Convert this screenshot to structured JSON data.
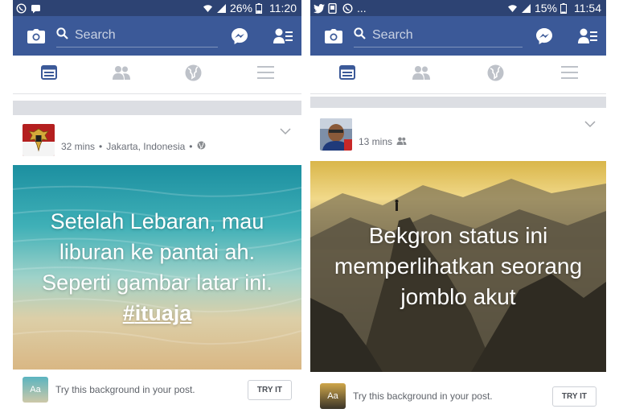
{
  "left": {
    "status_bar": {
      "battery": "26%",
      "time": "11:20"
    },
    "search": {
      "placeholder": "Search"
    },
    "post": {
      "time": "32 mins",
      "separator": "•",
      "location": "Jakarta, Indonesia",
      "background_text_line1": "Setelah Lebaran, mau",
      "background_text_line2": "liburan ke pantai ah.",
      "background_text_line3": "Seperti gambar latar ini.",
      "hashtag_prefix": "#",
      "hashtag": "ituaja"
    },
    "try_bar": {
      "thumb_label": "Aa",
      "text": "Try this background in your post.",
      "button": "TRY IT"
    }
  },
  "right": {
    "status_bar": {
      "extra": "...",
      "battery": "15%",
      "time": "11:54"
    },
    "search": {
      "placeholder": "Search"
    },
    "post": {
      "time": "13 mins",
      "background_text_line1": "Bekgron status ini",
      "background_text_line2": "memperlihatkan seorang",
      "background_text_line3": "jomblo akut"
    },
    "try_bar": {
      "thumb_label": "Aa",
      "text": "Try this background in your post.",
      "button": "TRY IT"
    }
  },
  "colors": {
    "header": "#3b5998",
    "status_bar": "#2d4373",
    "tab_active": "#3b5998",
    "tab_inactive": "#bec2c9"
  },
  "icons": [
    "whatsapp-icon",
    "message-icon",
    "twitter-icon",
    "notification-icon",
    "wifi-icon",
    "signal-icon",
    "battery-icon",
    "camera-icon",
    "search-icon",
    "messenger-icon",
    "friend-requests-icon",
    "news-feed-icon",
    "friends-icon",
    "globe-icon",
    "menu-icon",
    "chevron-down-icon"
  ]
}
